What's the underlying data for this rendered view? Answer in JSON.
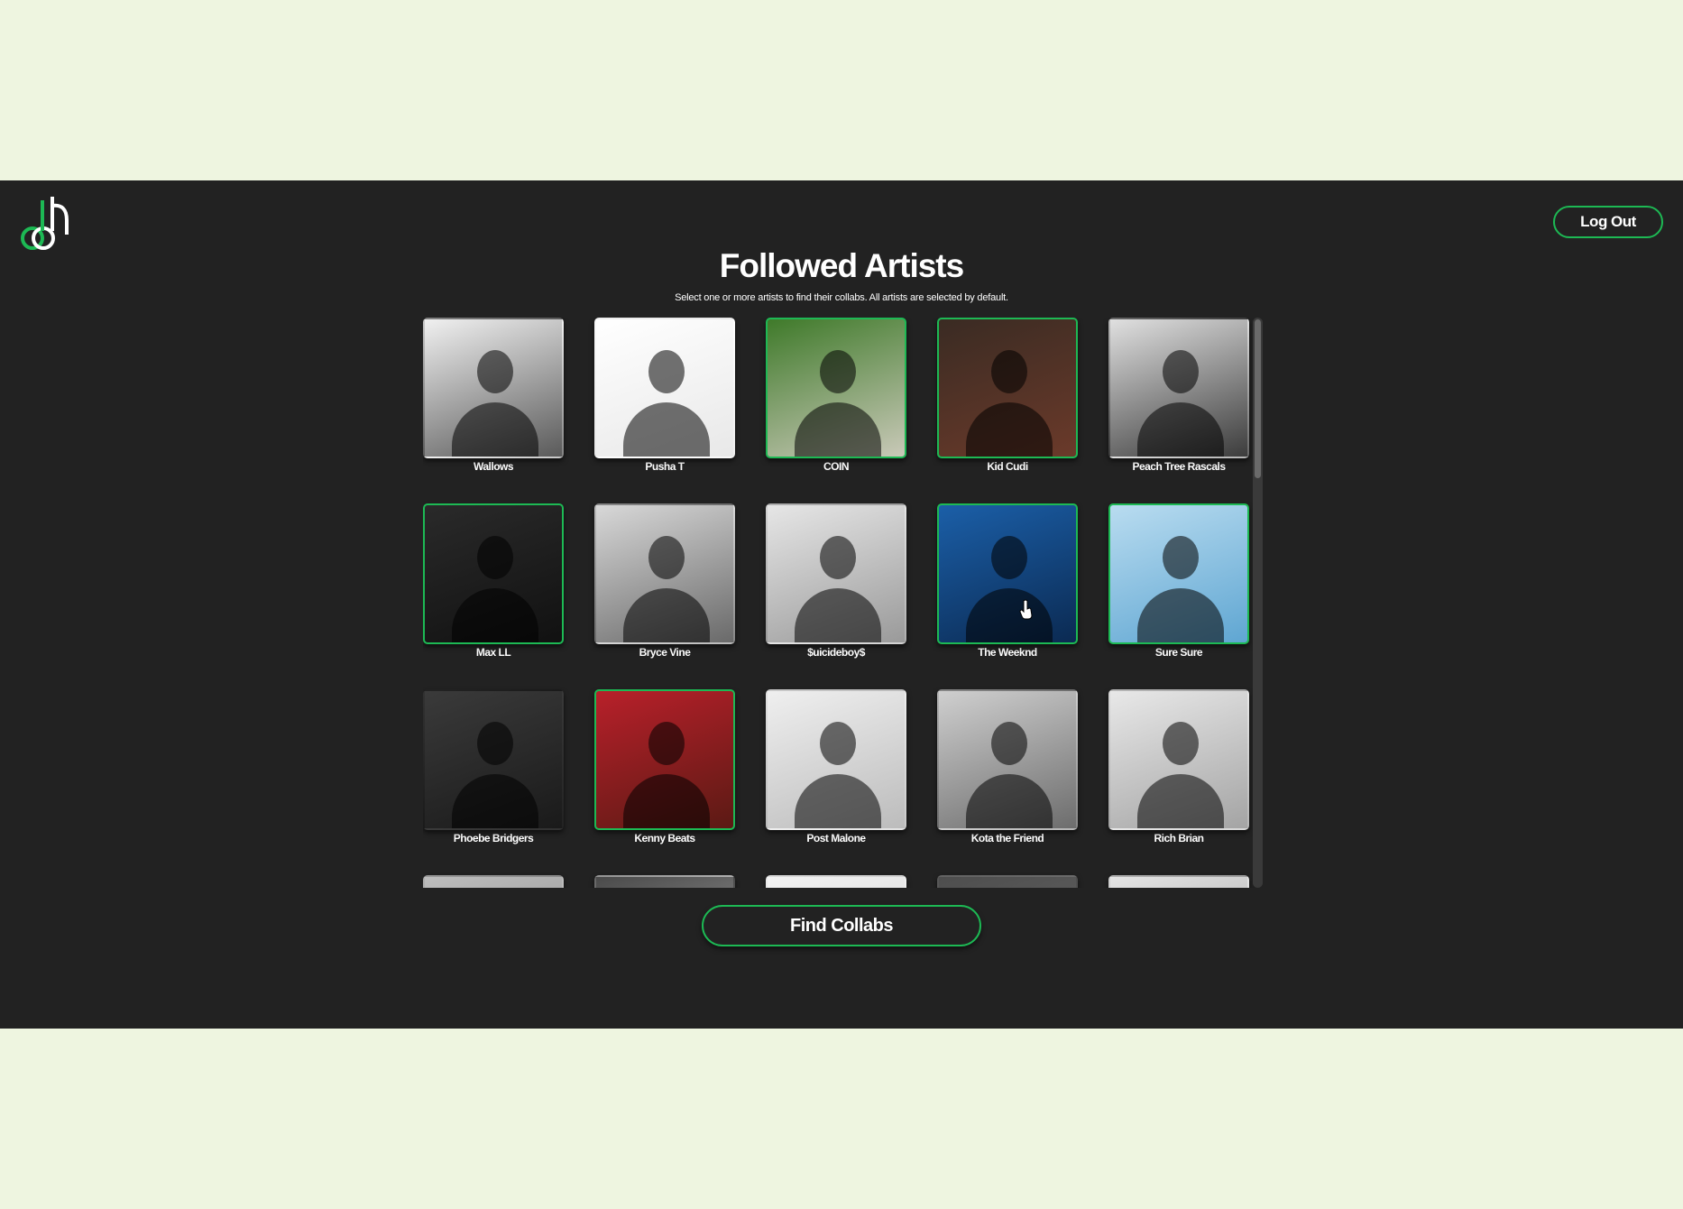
{
  "header": {
    "logo_icon": "music-note-logo-icon",
    "logout_label": "Log Out"
  },
  "main": {
    "title": "Followed Artists",
    "subtitle": "Select one or more artists to find their collabs. All artists are selected by default.",
    "find_collabs_label": "Find Collabs"
  },
  "artists": [
    {
      "name": "Wallows",
      "selected": false,
      "colors": [
        "#f0f0f0",
        "#5a5a5a"
      ]
    },
    {
      "name": "Pusha T",
      "selected": false,
      "colors": [
        "#ffffff",
        "#e8e8e8"
      ]
    },
    {
      "name": "COIN",
      "selected": true,
      "colors": [
        "#3f7a2a",
        "#c9c9b8"
      ]
    },
    {
      "name": "Kid Cudi",
      "selected": true,
      "colors": [
        "#3a2b23",
        "#6b3a2a"
      ]
    },
    {
      "name": "Peach Tree Rascals",
      "selected": false,
      "colors": [
        "#e0e0e0",
        "#3c3c3c"
      ]
    },
    {
      "name": "Max LL",
      "selected": true,
      "colors": [
        "#2a2a2a",
        "#111111"
      ]
    },
    {
      "name": "Bryce Vine",
      "selected": false,
      "colors": [
        "#d8d8d8",
        "#6a6a6a"
      ]
    },
    {
      "name": "$uicideboy$",
      "selected": false,
      "colors": [
        "#e6e6e6",
        "#9a9a9a"
      ]
    },
    {
      "name": "The Weeknd",
      "selected": true,
      "colors": [
        "#1b5fa8",
        "#0b2a52"
      ]
    },
    {
      "name": "Sure Sure",
      "selected": true,
      "colors": [
        "#b9dcf0",
        "#5fa6d2"
      ]
    },
    {
      "name": "Phoebe Bridgers",
      "selected": false,
      "colors": [
        "#3a3a3a",
        "#1a1a1a"
      ]
    },
    {
      "name": "Kenny Beats",
      "selected": true,
      "colors": [
        "#b8202a",
        "#5b1a14"
      ]
    },
    {
      "name": "Post Malone",
      "selected": false,
      "colors": [
        "#efefef",
        "#bcbcbc"
      ]
    },
    {
      "name": "Kota the Friend",
      "selected": false,
      "colors": [
        "#cfcfcf",
        "#6d6d6d"
      ]
    },
    {
      "name": "Rich Brian",
      "selected": false,
      "colors": [
        "#e8e8e8",
        "#a4a4a4"
      ]
    },
    {
      "name": "",
      "selected": false,
      "colors": [
        "#bdbdbd",
        "#8a8a8a"
      ]
    },
    {
      "name": "",
      "selected": false,
      "colors": [
        "#4a4a4a",
        "#b0b0b0"
      ]
    },
    {
      "name": "",
      "selected": false,
      "colors": [
        "#f2f2f2",
        "#d0d0d0"
      ]
    },
    {
      "name": "",
      "selected": false,
      "colors": [
        "#4e4e4e",
        "#6a6a6a"
      ]
    },
    {
      "name": "",
      "selected": false,
      "colors": [
        "#e4e4e4",
        "#9c9c9c"
      ]
    }
  ],
  "colors": {
    "accent": "#1db954",
    "panel": "#222222",
    "page": "#eef5e0"
  }
}
